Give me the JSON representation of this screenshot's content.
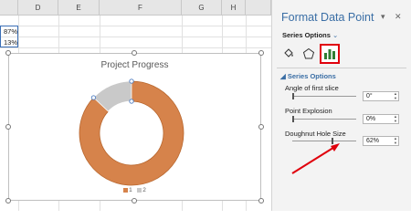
{
  "sheet": {
    "columns": [
      "D",
      "E",
      "F",
      "G",
      "H"
    ],
    "cells": [
      "87%",
      "13%"
    ]
  },
  "chart": {
    "title": "Project Progress",
    "legend": [
      {
        "label": "1",
        "color": "#d6834b"
      },
      {
        "label": "2",
        "color": "#c9c9c9"
      }
    ]
  },
  "chart_data": {
    "type": "pie",
    "title": "Project Progress",
    "categories": [
      "1",
      "2"
    ],
    "values": [
      87,
      13
    ],
    "colors": [
      "#d6834b",
      "#c9c9c9"
    ]
  },
  "pane": {
    "title": "Format Data Point",
    "series_options_tab": "Series Options",
    "section_label": "Series Options",
    "angle_label": "Angle of first slice",
    "angle_value": "0°",
    "explosion_label": "Point Explosion",
    "explosion_value": "0%",
    "hole_label": "Doughnut Hole Size",
    "hole_value": "62%",
    "hole_level": 0.62
  }
}
